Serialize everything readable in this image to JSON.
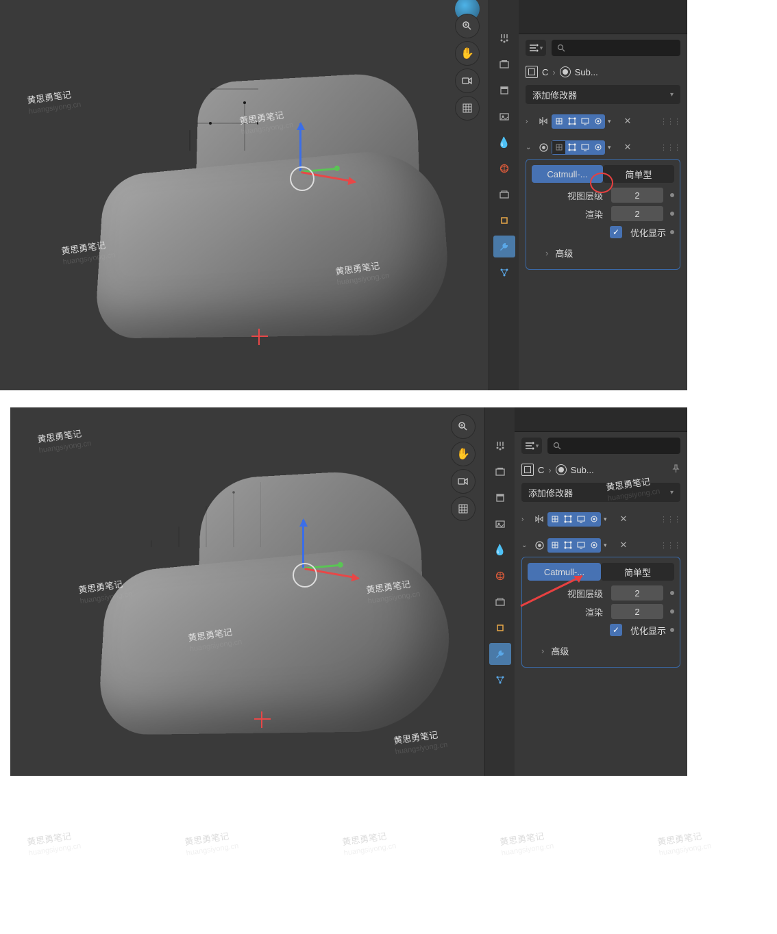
{
  "search": {
    "placeholder": ""
  },
  "breadcrumb": {
    "obj": "C",
    "mod": "Sub..."
  },
  "add_modifier_label": "添加修改器",
  "modifiers": {
    "m1": {
      "expanded_icon": "›"
    },
    "m2": {
      "type_tabs": {
        "catmull": "Catmull-...",
        "simple": "简单型"
      },
      "levels_viewport_label": "视图层级",
      "levels_viewport_value": "2",
      "levels_render_label": "渲染",
      "levels_render_value": "2",
      "optimal_display_label": "优化显示",
      "advanced_label": "高级"
    }
  },
  "watermark": {
    "cn": "黄思勇笔记",
    "en": "huangsiyong.cn"
  }
}
